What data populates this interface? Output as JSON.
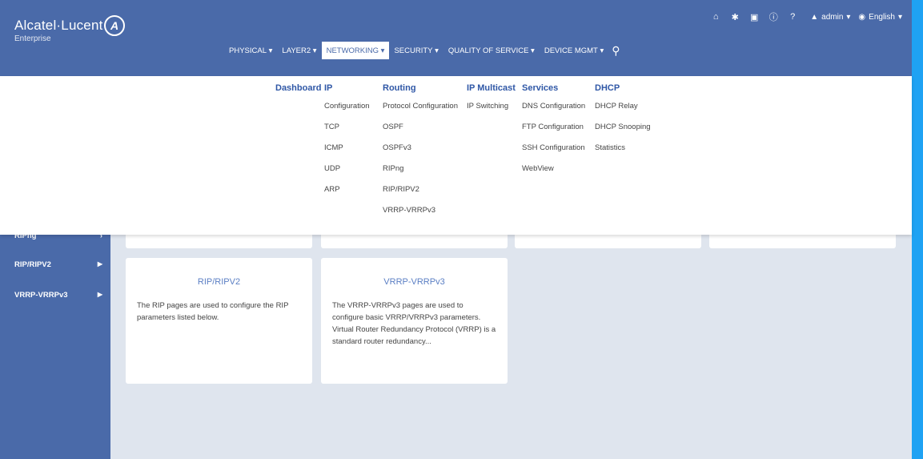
{
  "brand": {
    "name": "Alcatel·Lucent",
    "sub": "Enterprise"
  },
  "topbar": {
    "user": "admin",
    "language": "English"
  },
  "nav": [
    {
      "label": "PHYSICAL",
      "caret": true
    },
    {
      "label": "LAYER2",
      "caret": true
    },
    {
      "label": "NETWORKING",
      "caret": true
    },
    {
      "label": "SECURITY",
      "caret": true
    },
    {
      "label": "QUALITY OF SERVICE",
      "caret": true
    },
    {
      "label": "DEVICE MGMT",
      "caret": true
    }
  ],
  "mega": {
    "dashboard": "Dashboard",
    "ip": {
      "head": "IP",
      "links": [
        "Configuration",
        "TCP",
        "ICMP",
        "UDP",
        "ARP"
      ]
    },
    "routing": {
      "head": "Routing",
      "links": [
        "Protocol Configuration",
        "OSPF",
        "OSPFv3",
        "RIPng",
        "RIP/RIPV2",
        "VRRP-VRRPv3"
      ]
    },
    "multicast": {
      "head": "IP Multicast",
      "links": [
        "IP Switching"
      ]
    },
    "services": {
      "head": "Services",
      "links": [
        "DNS Configuration",
        "FTP Configuration",
        "SSH Configuration",
        "WebView"
      ]
    },
    "dhcp": {
      "head": "DHCP",
      "links": [
        "DHCP Relay",
        "DHCP Snooping",
        "Statistics"
      ]
    }
  },
  "sidebar": [
    {
      "label": "RIPng",
      "caret": "›"
    },
    {
      "label": "RIP/RIPV2",
      "caret": "›"
    },
    {
      "label": "VRRP-VRRPv3",
      "caret": "›"
    }
  ],
  "cards": {
    "rip": {
      "title": "RIP/RIPV2",
      "desc": "The RIP pages are used to configure the RIP parameters listed below."
    },
    "vrrp": {
      "title": "VRRP-VRRPv3",
      "desc": "The VRRP-VRRPv3 pages are used to configure basic VRRP/VRRPv3 parameters. Virtual Router Redundancy Protocol (VRRP) is a standard router redundancy..."
    }
  },
  "icons": {
    "home": "home-icon",
    "settings": "gear-icon",
    "save": "save-icon",
    "info": "info-icon",
    "help": "help-icon",
    "user": "user-icon",
    "globe": "globe-icon",
    "search": "search-icon"
  }
}
